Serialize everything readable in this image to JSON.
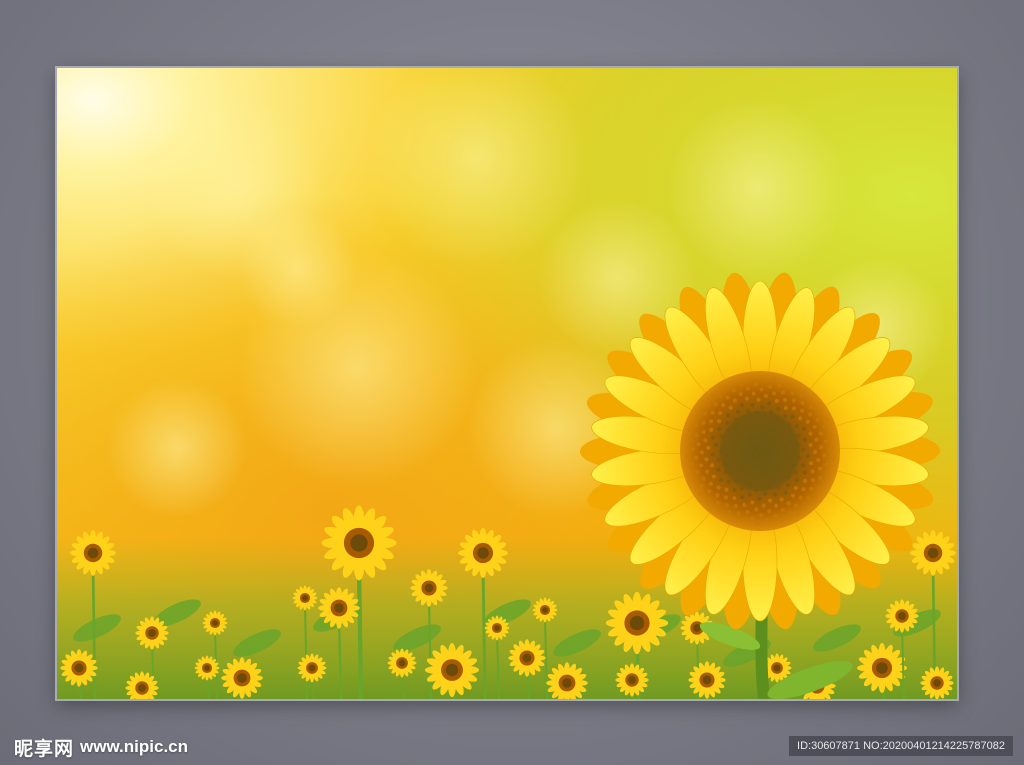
{
  "photo": {
    "subject": "sunflower-field",
    "colors": {
      "sky_warm": "#f7c21c",
      "sky_light": "#fff7b0",
      "sky_green": "#c9e33a",
      "petal": "#ffd21a",
      "petal_shadow": "#f2a900",
      "disc_outer": "#a85a00",
      "disc_inner": "#6b4a0a",
      "leaf": "#6aa42a"
    }
  },
  "watermark": {
    "logo_text": "昵享网",
    "url_text": "www.nipic.cn",
    "id_text": "ID:30607871 NO:20200401214225787082"
  }
}
